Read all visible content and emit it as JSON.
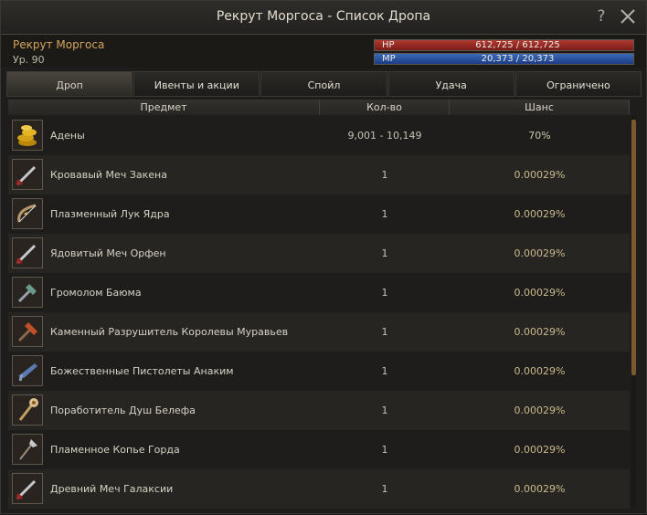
{
  "window": {
    "title": "Рекрут Моргоса - Список Дропа",
    "help_label": "?"
  },
  "npc": {
    "name": "Рекрут Моргоса",
    "level": "Ур. 90",
    "hp": {
      "label": "HP",
      "value": "612,725 / 612,725",
      "fraction": 1.0
    },
    "mp": {
      "label": "MP",
      "value": "20,373 / 20,373",
      "fraction": 1.0
    }
  },
  "tabs": [
    {
      "label": "Дроп",
      "active": true
    },
    {
      "label": "Ивенты и акции",
      "active": false
    },
    {
      "label": "Спойл",
      "active": false
    },
    {
      "label": "Удача",
      "active": false
    },
    {
      "label": "Ограничено",
      "active": false
    }
  ],
  "columns": {
    "item": "Предмет",
    "qty": "Кол-во",
    "chance": "Шанс"
  },
  "items": [
    {
      "name": "Адены",
      "qty": "9,001 - 10,149",
      "chance": "70%",
      "icon": "adena-coins-icon"
    },
    {
      "name": "Кровавый Меч Закена",
      "qty": "1",
      "chance": "0.00029%",
      "icon": "sword-icon"
    },
    {
      "name": "Плазменный Лук Ядра",
      "qty": "1",
      "chance": "0.00029%",
      "icon": "bow-icon"
    },
    {
      "name": "Ядовитый Меч Орфен",
      "qty": "1",
      "chance": "0.00029%",
      "icon": "sword-icon"
    },
    {
      "name": "Громолом Баюма",
      "qty": "1",
      "chance": "0.00029%",
      "icon": "blunt-icon"
    },
    {
      "name": "Каменный Разрушитель Королевы Муравьев",
      "qty": "1",
      "chance": "0.00029%",
      "icon": "hammer-icon"
    },
    {
      "name": "Божественные Пистолеты Анаким",
      "qty": "1",
      "chance": "0.00029%",
      "icon": "pistol-icon"
    },
    {
      "name": "Поработитель Душ Белефа",
      "qty": "1",
      "chance": "0.00029%",
      "icon": "staff-icon"
    },
    {
      "name": "Пламенное Копье Горда",
      "qty": "1",
      "chance": "0.00029%",
      "icon": "spear-icon"
    },
    {
      "name": "Древний Меч Галаксии",
      "qty": "1",
      "chance": "0.00029%",
      "icon": "sword-icon"
    }
  ],
  "colors": {
    "accent": "#d4a55a",
    "hp": "#9a2c24",
    "mp": "#2a58a8",
    "scrollbar": "#7a5a2e"
  }
}
